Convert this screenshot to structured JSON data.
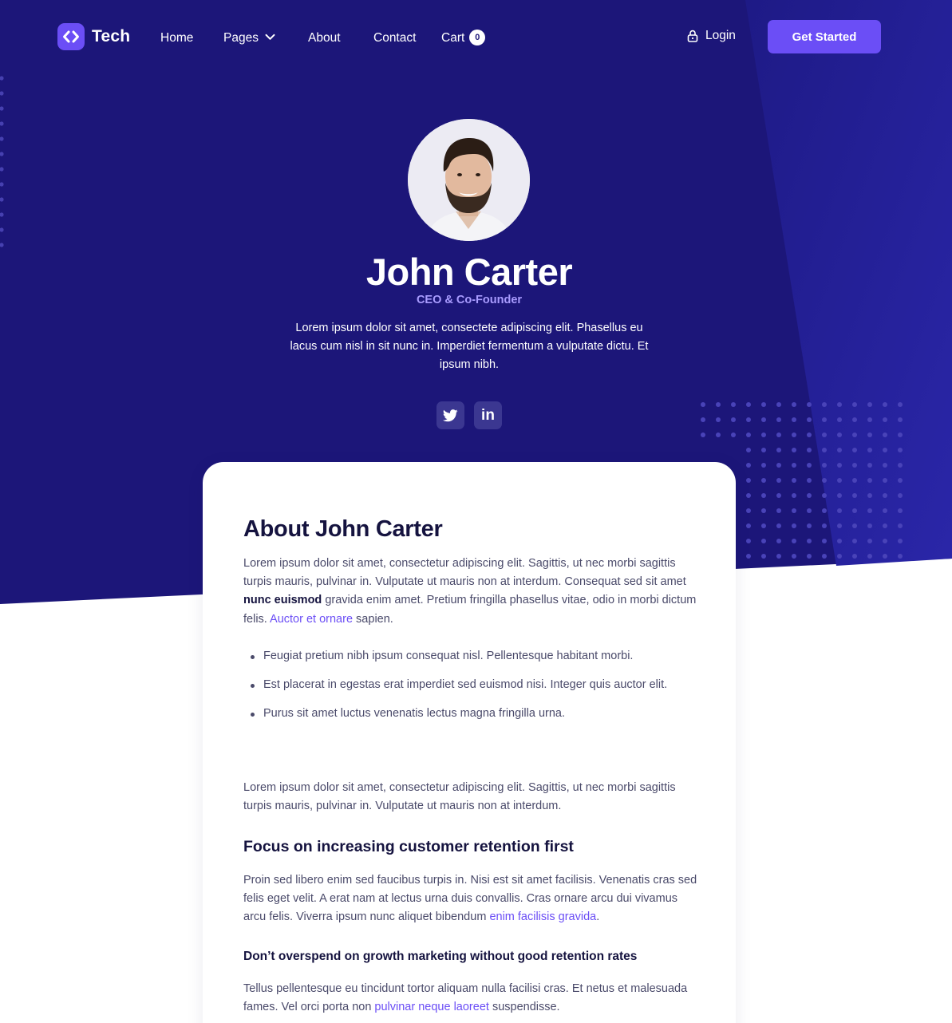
{
  "colors": {
    "hero_bg": "#1c1679",
    "hero_panel": "#24209a",
    "accent": "#6b4ef6",
    "role_text": "#a99cff",
    "heading": "#15133f",
    "body_text": "#4a4a6a",
    "link": "#6b4ef6"
  },
  "nav": {
    "logo_icon": "code-brackets-icon",
    "logo_text": "Tech",
    "home": "Home",
    "pages": "Pages",
    "pages_icon": "chevron-down-icon",
    "about": "About",
    "contact": "Contact",
    "cart": "Cart",
    "cart_count": "0",
    "login": "Login",
    "login_icon": "lock-icon",
    "cta": "Get Started"
  },
  "profile": {
    "avatar_alt": "John Carter portrait",
    "name": "John Carter",
    "role": "CEO & Co-Founder",
    "bio": "Lorem ipsum dolor sit amet, consectete adipiscing elit. Phasellus eu lacus cum nisl in sit nunc in. Imperdiet fermentum a vulputate dictu. Et ipsum nibh.",
    "social": [
      {
        "icon": "twitter-icon"
      },
      {
        "icon": "linkedin-icon",
        "label": "in"
      }
    ]
  },
  "about": {
    "title": "About John Carter",
    "intro_part1": "Lorem ipsum dolor sit amet, consectetur adipiscing elit. Sagittis, ut nec morbi sagittis turpis mauris, pulvinar in. Vulputate ut mauris non at interdum. Consequat sed sit amet ",
    "intro_bold": "nunc euismod",
    "intro_part2": " gravida enim amet. Pretium fringilla phasellus vitae, odio in morbi dictum felis. ",
    "intro_link": "Auctor et ornare",
    "intro_part3": " sapien.",
    "bullets": [
      "Feugiat pretium nibh ipsum consequat nisl. Pellentesque habitant morbi.",
      "Est placerat in egestas erat imperdiet sed euismod nisi. Integer quis auctor elit.",
      "Purus sit amet luctus venenatis lectus magna fringilla urna."
    ],
    "para2": "Lorem ipsum dolor sit amet, consectetur adipiscing elit. Sagittis, ut nec morbi sagittis turpis mauris, pulvinar in. Vulputate ut mauris non at interdum.",
    "h2": "Focus on increasing customer retention first",
    "para3_part1": "Proin sed libero enim sed faucibus turpis in. Nisi est sit amet facilisis. Venenatis cras sed felis eget velit. A erat nam at lectus urna duis convallis. Cras ornare arcu dui vivamus arcu felis. Viverra ipsum nunc aliquet bibendum ",
    "para3_link": "enim facilisis gravida",
    "para3_part2": ".",
    "h3": "Don’t overspend on growth marketing without good retention rates",
    "para4_part1": "Tellus pellentesque eu tincidunt tortor aliquam nulla facilisi cras. Et netus et malesuada fames. Vel orci porta non ",
    "para4_link": "pulvinar neque laoreet",
    "para4_part2": " suspendisse."
  }
}
